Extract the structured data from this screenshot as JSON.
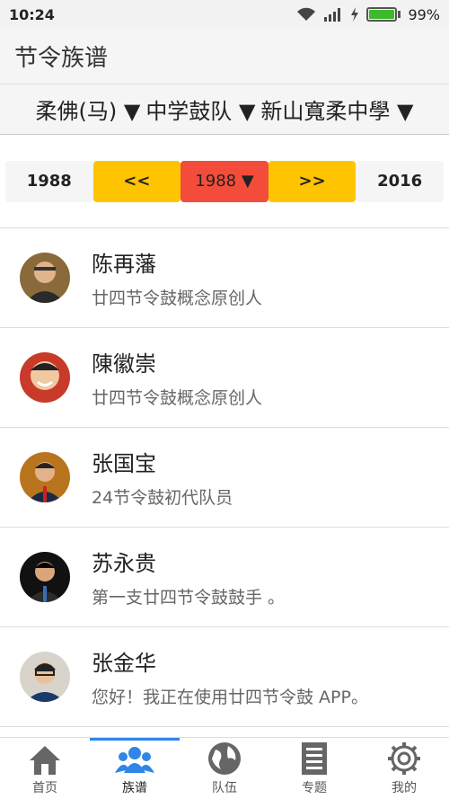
{
  "status": {
    "time": "10:24",
    "battery": "99%",
    "battery_level": 0.99
  },
  "app_bar": {
    "title": "节令族谱"
  },
  "breadcrumb": {
    "item1": "柔佛(马) ▼",
    "item2": "中学鼓队 ▼",
    "item3": "新山寬柔中學 ▼"
  },
  "year_nav": {
    "start": "1988",
    "prev": "<<",
    "current": "1988 ▼",
    "next": ">>",
    "end": "2016"
  },
  "people": [
    {
      "name": "陈再藩",
      "desc": "廿四节令鼓概念原创人"
    },
    {
      "name": "陳徽崇",
      "desc": "廿四节令鼓概念原创人"
    },
    {
      "name": "张国宝",
      "desc": "24节令鼓初代队员"
    },
    {
      "name": "苏永贵",
      "desc": "第一支廿四节令鼓鼓手 。"
    },
    {
      "name": "张金华",
      "desc": "您好！我正在使用廿四节令鼓 APP。"
    }
  ],
  "bottom_nav": {
    "home": "首页",
    "genealogy": "族谱",
    "team": "队伍",
    "topics": "专题",
    "mine": "我的"
  },
  "colors": {
    "active_tab": "#2f86e6",
    "yellow": "#ffc400",
    "red": "#f44c3b"
  }
}
